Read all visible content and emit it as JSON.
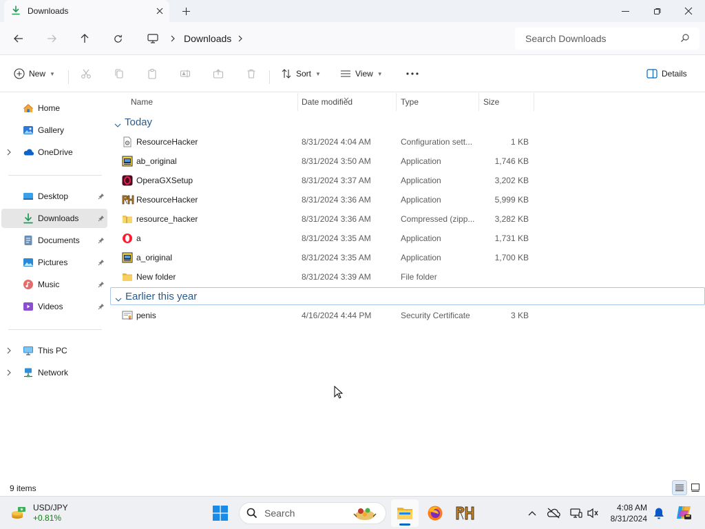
{
  "window": {
    "tab_title": "Downloads",
    "icons": {
      "tab": "download-icon",
      "close_tab": "close-icon",
      "new_tab": "plus-icon"
    }
  },
  "address_bar": {
    "breadcrumb": "Downloads",
    "search_placeholder": "Search Downloads"
  },
  "command_bar": {
    "new_label": "New",
    "sort_label": "Sort",
    "view_label": "View",
    "details_label": "Details"
  },
  "sidebar": {
    "items": [
      {
        "label": "Home",
        "icon": "home-icon"
      },
      {
        "label": "Gallery",
        "icon": "gallery-icon"
      },
      {
        "label": "OneDrive",
        "icon": "onedrive-icon"
      },
      {
        "label": "Desktop",
        "icon": "desktop-icon"
      },
      {
        "label": "Downloads",
        "icon": "download-icon"
      },
      {
        "label": "Documents",
        "icon": "documents-icon"
      },
      {
        "label": "Pictures",
        "icon": "pictures-icon"
      },
      {
        "label": "Music",
        "icon": "music-icon"
      },
      {
        "label": "Videos",
        "icon": "videos-icon"
      },
      {
        "label": "This PC",
        "icon": "this-pc-icon"
      },
      {
        "label": "Network",
        "icon": "network-icon"
      }
    ]
  },
  "columns": [
    "Name",
    "Date modified",
    "Type",
    "Size"
  ],
  "groups": [
    {
      "label": "Today",
      "files": [
        {
          "name": "ResourceHacker",
          "date": "8/31/2024 4:04 AM",
          "type": "Configuration sett...",
          "size": "1 KB",
          "icon": "config-file-icon"
        },
        {
          "name": "ab_original",
          "date": "8/31/2024 3:50 AM",
          "type": "Application",
          "size": "1,746 KB",
          "icon": "installer-icon"
        },
        {
          "name": "OperaGXSetup",
          "date": "8/31/2024 3:37 AM",
          "type": "Application",
          "size": "3,202 KB",
          "icon": "opera-gx-icon"
        },
        {
          "name": "ResourceHacker",
          "date": "8/31/2024 3:36 AM",
          "type": "Application",
          "size": "5,999 KB",
          "icon": "resource-hacker-icon"
        },
        {
          "name": "resource_hacker",
          "date": "8/31/2024 3:36 AM",
          "type": "Compressed (zipp...",
          "size": "3,282 KB",
          "icon": "zip-folder-icon"
        },
        {
          "name": "a",
          "date": "8/31/2024 3:35 AM",
          "type": "Application",
          "size": "1,731 KB",
          "icon": "opera-icon"
        },
        {
          "name": "a_original",
          "date": "8/31/2024 3:35 AM",
          "type": "Application",
          "size": "1,700 KB",
          "icon": "installer-icon"
        },
        {
          "name": "New folder",
          "date": "8/31/2024 3:39 AM",
          "type": "File folder",
          "size": "",
          "icon": "folder-icon"
        }
      ]
    },
    {
      "label": "Earlier this year",
      "files": [
        {
          "name": "penis",
          "date": "4/16/2024 4:44 PM",
          "type": "Security Certificate",
          "size": "3 KB",
          "icon": "certificate-icon"
        }
      ]
    }
  ],
  "status": {
    "item_count": "9 items"
  },
  "taskbar": {
    "widget_title": "USD/JPY",
    "widget_change": "+0.81%",
    "search_label": "Search",
    "time": "4:08 AM",
    "date": "8/31/2024"
  }
}
